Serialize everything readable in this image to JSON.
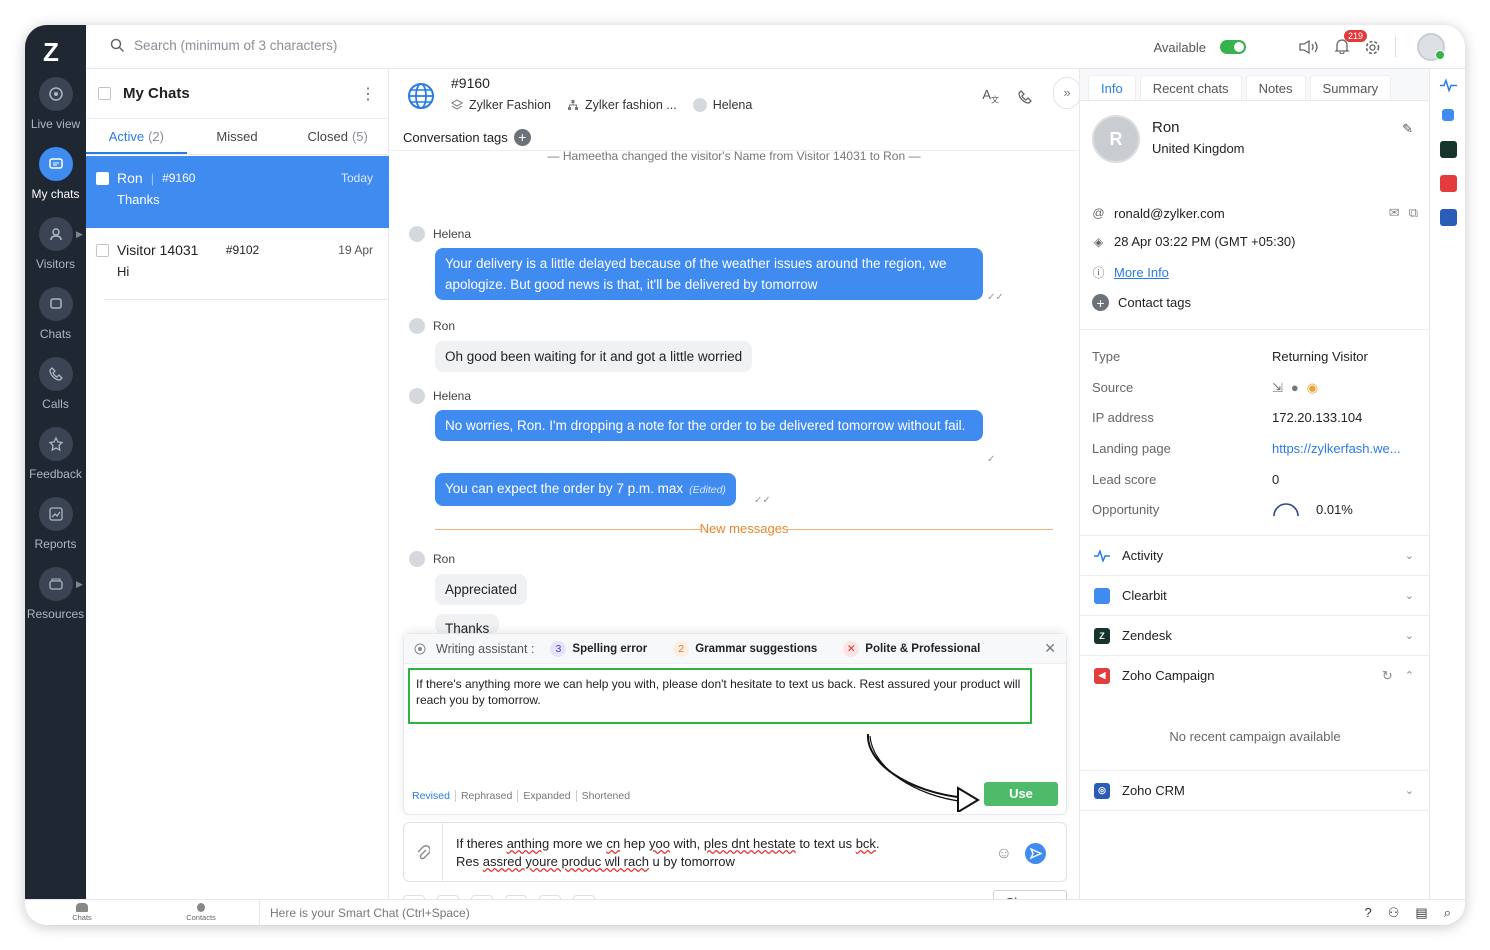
{
  "rail": {
    "items": [
      {
        "label": "Live view"
      },
      {
        "label": "My chats"
      },
      {
        "label": "Visitors"
      },
      {
        "label": "Chats"
      },
      {
        "label": "Calls"
      },
      {
        "label": "Feedback"
      },
      {
        "label": "Reports"
      },
      {
        "label": "Resources"
      }
    ],
    "logo": "Z"
  },
  "topbar": {
    "search_placeholder": "Search (minimum of 3 characters)",
    "availability": "Available",
    "notifications": "219"
  },
  "list": {
    "title": "My Chats",
    "tabs": [
      {
        "label": "Active",
        "count": "(2)"
      },
      {
        "label": "Missed",
        "count": ""
      },
      {
        "label": "Closed",
        "count": "(5)"
      }
    ],
    "items": [
      {
        "name": "Ron",
        "id": "#9160",
        "date": "Today",
        "msg": "Thanks"
      },
      {
        "name": "Visitor 14031",
        "id": "#9102",
        "date": "19 Apr",
        "msg": "Hi"
      }
    ]
  },
  "chat": {
    "id": "#9160",
    "brand": "Zylker Fashion",
    "dept": "Zylker fashion ...",
    "agent": "Helena",
    "tags_label": "Conversation tags",
    "system": "— Hameetha changed the visitor's Name from Visitor 14031 to Ron —",
    "messages": [
      {
        "sender": "Helena",
        "text": "Your delivery is a little delayed because of the weather issues around the region, we apologize. But good news is that, it'll be delivered by tomorrow"
      },
      {
        "sender": "Ron",
        "text": "Oh good been waiting for it and got a little worried"
      },
      {
        "sender": "Helena",
        "text": "No worries, Ron. I'm dropping a note for the order to be delivered tomorrow without fail."
      },
      {
        "text": "You can expect the order by 7 p.m. max",
        "edited": "(Edited)"
      },
      {
        "sender": "Ron",
        "text": "Appreciated"
      },
      {
        "text": "Thanks"
      }
    ],
    "new_messages": "New messages"
  },
  "assistant": {
    "title": "Writing assistant :",
    "chips": [
      {
        "n": "3",
        "label": "Spelling error"
      },
      {
        "n": "2",
        "label": "Grammar suggestions"
      },
      {
        "n": "✕",
        "label": "Polite & Professional"
      }
    ],
    "suggestion": "If there's anything more we can help you with, please don't hesitate to text us back. Rest assured your product will reach you by tomorrow.",
    "modes": [
      "Revised",
      "Rephrased",
      "Expanded",
      "Shortened"
    ],
    "use": "Use"
  },
  "composer": {
    "line1_a": "If theres ",
    "line1_b": "anthing",
    "line1_c": " more we ",
    "line1_d": "cn",
    "line1_e": " hep ",
    "line1_f": "yoo",
    "line1_g": " with, ",
    "line1_h": "ples dnt hestate",
    "line1_i": " to text us ",
    "line1_j": "bck",
    "line2_a": "Res ",
    "line2_b": "assred youre produc wll rach",
    "line2_c": " u by tomorrow",
    "close": "Close"
  },
  "info": {
    "tabs": [
      "Info",
      "Recent chats",
      "Notes",
      "Summary"
    ],
    "name": "Ron",
    "country": "United Kingdom",
    "avatar": "R",
    "email": "ronald@zylker.com",
    "time": "28 Apr 03:22 PM  (GMT +05:30)",
    "more_info": "More Info",
    "contact_tags": "Contact tags",
    "fields": [
      {
        "k": "Type",
        "v": "Returning Visitor"
      },
      {
        "k": "Source",
        "v": ""
      },
      {
        "k": "IP address",
        "v": "172.20.133.104"
      },
      {
        "k": "Landing page",
        "v": "https://zylkerfash.we..."
      },
      {
        "k": "Lead score",
        "v": "0"
      },
      {
        "k": "Opportunity",
        "v": "0.01%"
      }
    ],
    "sections": [
      "Activity",
      "Clearbit",
      "Zendesk",
      "Zoho Campaign",
      "Zoho CRM"
    ],
    "no_campaign": "No recent campaign available"
  },
  "status": {
    "chats": "Chats",
    "contacts": "Contacts",
    "smart": "Here is your Smart Chat (Ctrl+Space)"
  },
  "colors": {
    "accent": "#3f8bf0",
    "rail": "#1f2732",
    "green": "#4dbb6a",
    "highlight": "#2fb240"
  }
}
